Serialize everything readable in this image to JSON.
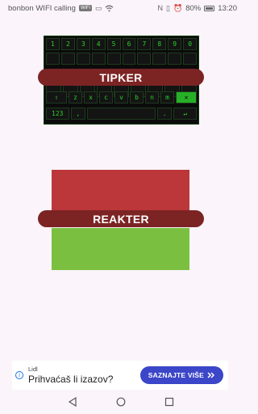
{
  "status_bar": {
    "carrier": "bonbon WIFI calling",
    "wifi_badge": "WiFi",
    "battery": "80%",
    "time": "13:20"
  },
  "tipker": {
    "label": "TIPKER",
    "number_row": [
      "1",
      "2",
      "3",
      "4",
      "5",
      "6",
      "7",
      "8",
      "9",
      "0"
    ],
    "letter_row": [
      "z",
      "x",
      "c",
      "v",
      "b",
      "n",
      "m"
    ],
    "bottom_left": "123",
    "accent_color": "#27d327"
  },
  "reakter": {
    "label": "REAKTER",
    "top_color": "#bb373a",
    "bottom_color": "#7bbf40"
  },
  "ad": {
    "advertiser": "Lidl",
    "headline": "Prihvaćaš li izazov?",
    "cta": "SAZNAJTE VIŠE",
    "cta_icon": "double-chevron-right-icon",
    "info_icon": "info-icon"
  },
  "nav": {
    "back_icon": "back-triangle-icon",
    "home_icon": "home-circle-icon",
    "recent_icon": "recent-square-icon"
  },
  "colors": {
    "pill": "#7c2424",
    "background": "#fbf4fb",
    "cta": "#3b46c8"
  }
}
